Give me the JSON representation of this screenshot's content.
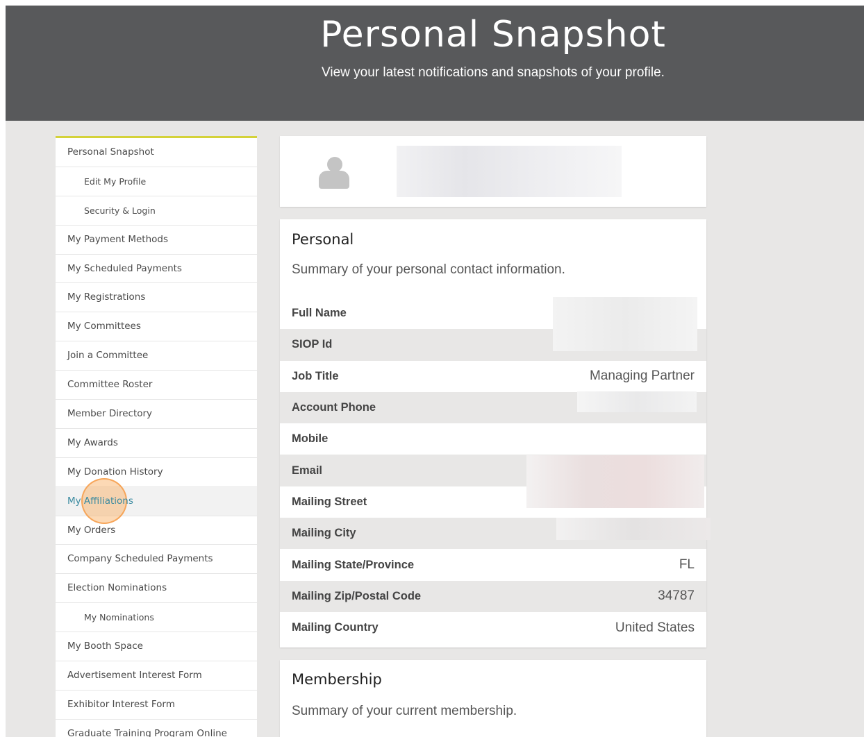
{
  "header": {
    "title": "Personal Snapshot",
    "subtitle": "View your latest notifications and snapshots of your profile."
  },
  "sidebar": {
    "items": [
      {
        "label": "Personal Snapshot"
      },
      {
        "label": "Edit My Profile"
      },
      {
        "label": "Security & Login"
      },
      {
        "label": "My Payment Methods"
      },
      {
        "label": "My Scheduled Payments"
      },
      {
        "label": "My Registrations"
      },
      {
        "label": "My Committees"
      },
      {
        "label": "Join a Committee"
      },
      {
        "label": "Committee Roster"
      },
      {
        "label": "Member Directory"
      },
      {
        "label": "My Awards"
      },
      {
        "label": "My Donation History"
      },
      {
        "label": "My Affiliations"
      },
      {
        "label": "My Orders"
      },
      {
        "label": "Company Scheduled Payments"
      },
      {
        "label": "Election Nominations"
      },
      {
        "label": "My Nominations"
      },
      {
        "label": "My Booth Space"
      },
      {
        "label": "Advertisement Interest Form"
      },
      {
        "label": "Exhibitor Interest Form"
      },
      {
        "label": "Graduate Training Program Online"
      }
    ]
  },
  "personal": {
    "title": "Personal",
    "subtitle": "Summary of your personal contact information.",
    "rows": [
      {
        "label": "Full Name",
        "value": ""
      },
      {
        "label": "SIOP Id",
        "value": ""
      },
      {
        "label": "Job Title",
        "value": "Managing Partner"
      },
      {
        "label": "Account Phone",
        "value": ""
      },
      {
        "label": "Mobile",
        "value": ""
      },
      {
        "label": "Email",
        "value": ""
      },
      {
        "label": "Mailing Street",
        "value": ""
      },
      {
        "label": "Mailing City",
        "value": ""
      },
      {
        "label": "Mailing State/Province",
        "value": "FL"
      },
      {
        "label": "Mailing Zip/Postal Code",
        "value": "34787"
      },
      {
        "label": "Mailing Country",
        "value": "United States"
      }
    ]
  },
  "membership": {
    "title": "Membership",
    "subtitle": "Summary of your current membership."
  },
  "colors": {
    "header_bg": "#58595b",
    "page_bg": "#e8e7e6",
    "sidebar_accent": "#d4d23a",
    "active_link": "#3a8aa0"
  }
}
